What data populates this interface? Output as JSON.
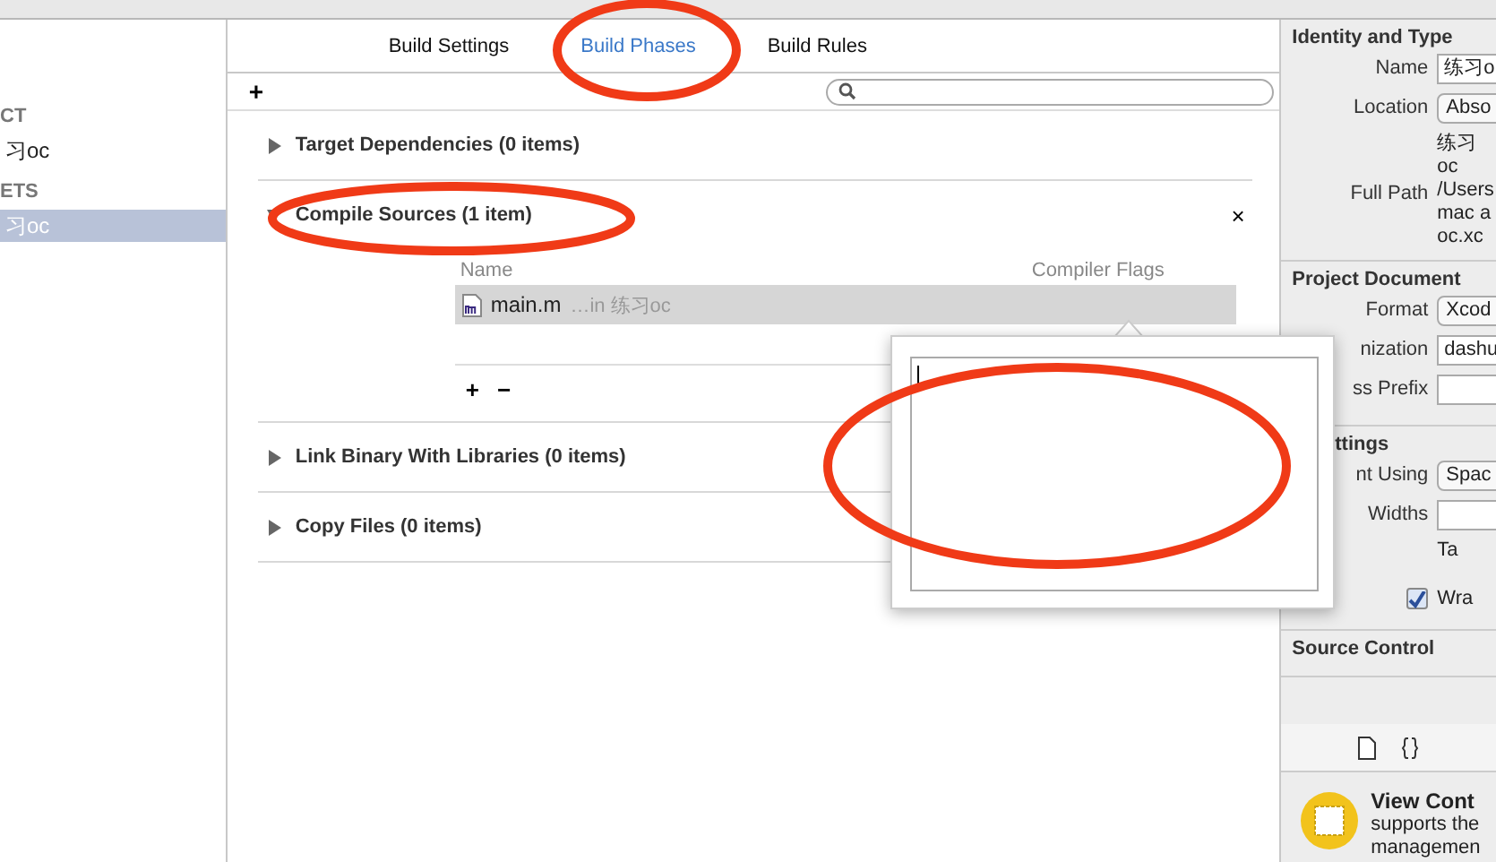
{
  "sidebar": {
    "sections": [
      {
        "header": "CT",
        "items": [
          {
            "label": "习oc",
            "selected": false
          }
        ]
      },
      {
        "header": "ETS",
        "items": [
          {
            "label": "习oc",
            "selected": true
          }
        ]
      }
    ]
  },
  "tabs": [
    {
      "label": "Build Settings",
      "selected": false
    },
    {
      "label": "Build Phases",
      "selected": true
    },
    {
      "label": "Build Rules",
      "selected": false
    }
  ],
  "toolbar": {
    "add": "+"
  },
  "phases": [
    {
      "title": "Target Dependencies (0 items)",
      "expanded": false
    },
    {
      "title": "Compile Sources (1 item)",
      "expanded": true,
      "close": "×",
      "columns": [
        "Name",
        "Compiler Flags"
      ],
      "files": [
        {
          "name": "main.m",
          "location": "…in 练习oc",
          "selected": true
        }
      ],
      "add": "+",
      "remove": "−"
    },
    {
      "title": "Link Binary With Libraries (0 items)",
      "expanded": false
    },
    {
      "title": "Copy Files (0 items)",
      "expanded": false
    }
  ],
  "inspector": {
    "sections": [
      {
        "title": "Identity and Type",
        "rows": [
          {
            "kind": "field",
            "label": "Name",
            "value": "练习o"
          },
          {
            "kind": "popup",
            "label": "Location",
            "value": "Abso"
          },
          {
            "kind": "text",
            "lines": [
              "练习oc"
            ]
          },
          {
            "kind": "text",
            "label": "Full Path",
            "lines": [
              "/Users",
              "mac a",
              "oc.xc"
            ]
          }
        ]
      },
      {
        "title": "Project Document",
        "rows": [
          {
            "kind": "popup",
            "label": "Format",
            "value": "Xcod"
          },
          {
            "kind": "field",
            "label": "nization",
            "value": "dashu"
          },
          {
            "kind": "field",
            "label": "ss Prefix"
          }
        ]
      },
      {
        "title": "ttings",
        "rows": [
          {
            "kind": "popup",
            "label": "nt Using",
            "value": "Spac"
          },
          {
            "kind": "field",
            "label": "Widths"
          },
          {
            "kind": "text",
            "lines": [
              "Ta"
            ]
          },
          {
            "kind": "checkbox",
            "label": "Wra",
            "checked": true
          }
        ]
      },
      {
        "title": "Source Control"
      }
    ],
    "library": {
      "title": "View Cont",
      "lines": [
        "supports the",
        "managemen"
      ]
    }
  }
}
